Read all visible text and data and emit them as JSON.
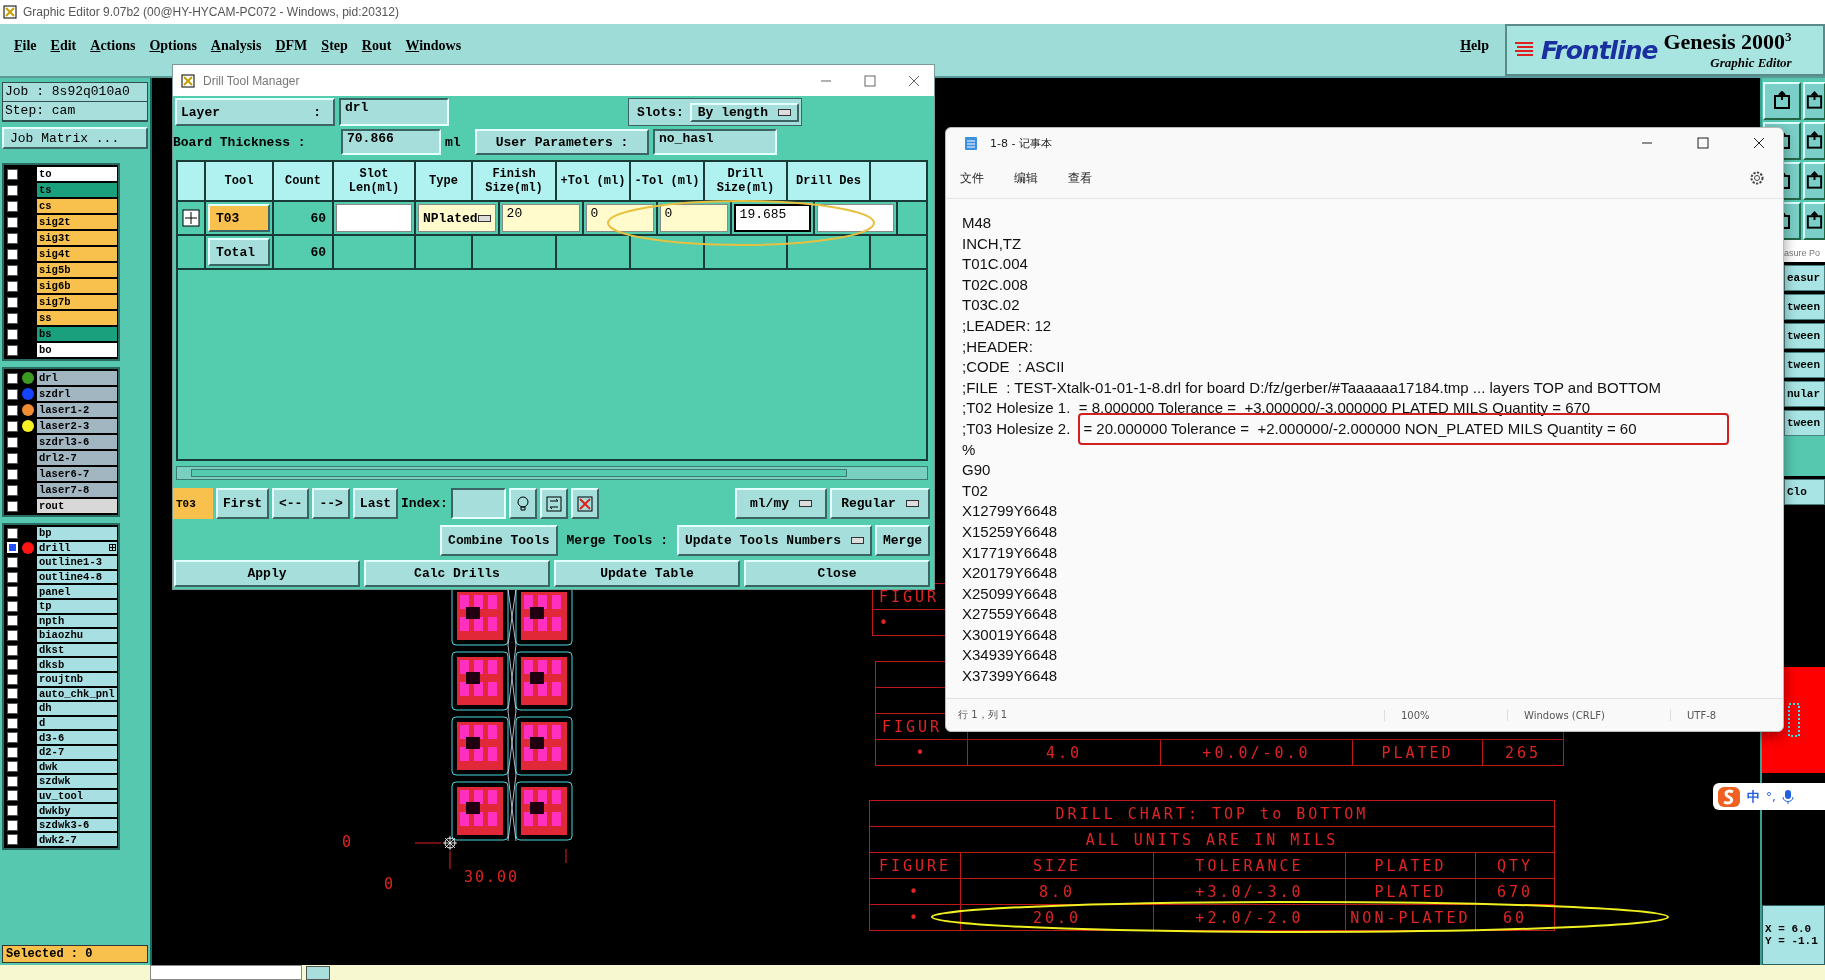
{
  "app": {
    "title": "Graphic Editor 9.07b2 (00@HY-HYCAM-PC072 - Windows, pid:20312)",
    "menus": [
      "File",
      "Edit",
      "Actions",
      "Options",
      "Analysis",
      "DFM",
      "Step",
      "Rout",
      "Windows"
    ],
    "help": "Help",
    "logo": {
      "brand": "Frontline",
      "product": "Genesis 2000",
      "superscript": "3",
      "subtitle": "Graphic Editor"
    }
  },
  "job_panel": {
    "job": "Job : 8s92q010a0",
    "step": "Step: cam",
    "matrix_button": "Job Matrix ...",
    "layer_groups": [
      {
        "layers": [
          {
            "name": "to",
            "kind": "silk",
            "selected": false
          },
          {
            "name": "ts",
            "kind": "mask",
            "selected": false
          },
          {
            "name": "cs",
            "kind": "signal",
            "selected": false
          },
          {
            "name": "sig2t",
            "kind": "signal",
            "selected": false
          },
          {
            "name": "sig3t",
            "kind": "signal",
            "selected": false
          },
          {
            "name": "sig4t",
            "kind": "signal",
            "selected": false
          },
          {
            "name": "sig5b",
            "kind": "signal",
            "selected": false
          },
          {
            "name": "sig6b",
            "kind": "signal",
            "selected": false
          },
          {
            "name": "sig7b",
            "kind": "signal",
            "selected": false
          },
          {
            "name": "ss",
            "kind": "signal",
            "selected": false
          },
          {
            "name": "bs",
            "kind": "mask",
            "selected": false
          },
          {
            "name": "bo",
            "kind": "silk",
            "selected": false
          }
        ]
      },
      {
        "layers": [
          {
            "name": "drl",
            "kind": "drill",
            "color": "#3c9a22",
            "selected": false
          },
          {
            "name": "szdrl",
            "kind": "drill",
            "color": "#1444ff",
            "selected": false
          },
          {
            "name": "laser1-2",
            "kind": "drill",
            "color": "#f28c32",
            "selected": false
          },
          {
            "name": "laser2-3",
            "kind": "drill",
            "color": "#f8f024",
            "selected": false
          },
          {
            "name": "szdrl3-6",
            "kind": "drill",
            "selected": false
          },
          {
            "name": "drl2-7",
            "kind": "drill",
            "selected": false
          },
          {
            "name": "laser6-7",
            "kind": "drill",
            "selected": false
          },
          {
            "name": "laser7-8",
            "kind": "drill",
            "selected": false
          },
          {
            "name": "rout",
            "kind": "rout",
            "selected": false
          }
        ]
      },
      {
        "layers": [
          {
            "name": "bp",
            "kind": "misc",
            "selected": false
          },
          {
            "name": "drill",
            "kind": "misc",
            "color": "#ff1414",
            "selected": true
          },
          {
            "name": "outline1-3",
            "kind": "misc",
            "selected": false
          },
          {
            "name": "outline4-8",
            "kind": "misc",
            "selected": false
          },
          {
            "name": "panel",
            "kind": "misc",
            "selected": false
          },
          {
            "name": "tp",
            "kind": "misc",
            "selected": false
          },
          {
            "name": "npth",
            "kind": "misc",
            "selected": false
          },
          {
            "name": "biaozhu",
            "kind": "misc",
            "selected": false
          },
          {
            "name": "dkst",
            "kind": "misc",
            "selected": false
          },
          {
            "name": "dksb",
            "kind": "misc",
            "selected": false
          },
          {
            "name": "roujtnb",
            "kind": "misc",
            "selected": false
          },
          {
            "name": "auto_chk_pnl",
            "kind": "misc",
            "selected": false
          },
          {
            "name": "dh",
            "kind": "misc",
            "selected": false
          },
          {
            "name": "d",
            "kind": "misc",
            "selected": false
          },
          {
            "name": "d3-6",
            "kind": "misc",
            "selected": false
          },
          {
            "name": "d2-7",
            "kind": "misc",
            "selected": false
          },
          {
            "name": "dwk",
            "kind": "misc",
            "selected": false
          },
          {
            "name": "szdwk",
            "kind": "misc",
            "selected": false
          },
          {
            "name": "uv_tool",
            "kind": "misc",
            "selected": false
          },
          {
            "name": "dwkby",
            "kind": "misc",
            "selected": false
          },
          {
            "name": "szdwk3-6",
            "kind": "misc",
            "selected": false
          },
          {
            "name": "dwk2-7",
            "kind": "misc",
            "selected": false
          }
        ]
      }
    ],
    "selected_count": "Selected : 0"
  },
  "drill_manager": {
    "title": "Drill Tool Manager",
    "layer": {
      "label": "Layer",
      "suffix": ":",
      "value": "drl"
    },
    "slots": {
      "label": "Slots:",
      "value": "By length"
    },
    "board_thickness": {
      "label": "Board Thickness :",
      "value": "70.866",
      "unit": "ml"
    },
    "user_parameters": {
      "label": "User Parameters :",
      "value": "no_hasl"
    },
    "table": {
      "columns": [
        "Tool",
        "Count",
        "Slot Len(ml)",
        "Type",
        "Finish Size(ml)",
        "+Tol (ml)",
        "-Tol (ml)",
        "Drill Size(ml)",
        "Drill Des"
      ],
      "rows": [
        {
          "kind": "tool",
          "tool": "T03",
          "count": "60",
          "slot_len": {
            "modified": false
          },
          "type": {
            "value": "NPlated",
            "modified": true
          },
          "finish_size": {
            "value": "20",
            "modified": true
          },
          "plus_tol": {
            "value": "0",
            "modified": true
          },
          "minus_tol": {
            "value": "0",
            "modified": true
          },
          "drill_size": {
            "value": "19.685",
            "modified": false
          },
          "drill_des": {
            "modified": false
          }
        },
        {
          "kind": "total",
          "tool": "Total",
          "count": "60"
        }
      ]
    },
    "current_tool": "T03",
    "nav_buttons": [
      "First",
      "<--",
      "-->",
      "Last"
    ],
    "index_label": "Index:",
    "units": "ml/my",
    "mode": "Regular",
    "combine_button": "Combine Tools",
    "merge_label": "Merge Tools :",
    "merge_option": "Update Tools Numbers",
    "merge_button": "Merge",
    "actions": [
      "Apply",
      "Calc Drills",
      "Update Table",
      "Close"
    ]
  },
  "notepad": {
    "title": "1-8 - 记事本",
    "menus": [
      "文件",
      "编辑",
      "查看"
    ],
    "lines": [
      {
        "text": "M48"
      },
      {
        "text": "INCH,TZ"
      },
      {
        "text": "T01C.004"
      },
      {
        "text": "T02C.008"
      },
      {
        "text": "T03C.02"
      },
      {
        "text": ";LEADER: 12"
      },
      {
        "text": ";HEADER:"
      },
      {
        "text": ";CODE  : ASCII"
      },
      {
        "text": ";FILE  : TEST-Xtalk-01-01-1-8.drl for board D:/fz/gerber/#Taaaaaa17184.tmp ... layers TOP and BOTTOM"
      },
      {
        "text": ";T02 Holesize 1.  = 8.000000 Tolerance =  +3.000000/-3.000000 PLATED MILS Quantity = 670"
      },
      {
        "text": ";T03 Holesize 2.",
        "marked": "= 20.000000 Tolerance =  +2.000000/-2.000000 NON_PLATED MILS Quantity = 60"
      },
      {
        "text": "%"
      },
      {
        "text": "G90"
      },
      {
        "text": "T02"
      },
      {
        "text": "X12799Y6648"
      },
      {
        "text": "X15259Y6648"
      },
      {
        "text": "X17719Y6648"
      },
      {
        "text": "X20179Y6648"
      },
      {
        "text": "X25099Y6648"
      },
      {
        "text": "X27559Y6648"
      },
      {
        "text": "X30019Y6648"
      },
      {
        "text": "X34939Y6648"
      },
      {
        "text": "X37399Y6648"
      }
    ],
    "status": {
      "position": "行 1，列 1",
      "zoom": "100%",
      "line_ending": "Windows (CRLF)",
      "encoding": "UTF-8"
    }
  },
  "canvas": {
    "chart_a": {
      "header_fragment": "FIGUR",
      "row_fragment": "•"
    },
    "chart_b": {
      "header_fragment": "FIGUR",
      "row": [
        "•",
        "4.0",
        "+0.0/-0.0",
        "PLATED",
        "265"
      ]
    },
    "drill_chart": {
      "title": "DRILL CHART: TOP to BOTTOM",
      "subtitle": "ALL UNITS ARE IN MILS",
      "columns": [
        "FIGURE",
        "SIZE",
        "TOLERANCE",
        "PLATED",
        "QTY"
      ],
      "rows": [
        [
          "•",
          "8.0",
          "+3.0/-3.0",
          "PLATED",
          "670"
        ],
        [
          "•",
          "20.0",
          "+2.0/-2.0",
          "NON-PLATED",
          "60"
        ]
      ]
    },
    "axis": {
      "y_origin": "0",
      "x_origin": "0",
      "x_end": "30.00"
    }
  },
  "right_panel": {
    "heading_fragment": "asure Po",
    "items": [
      "easur",
      "tween",
      "tween",
      "tween",
      "nular",
      "tween"
    ],
    "close_fragment": "Clo",
    "coords": [
      "X = 6.0",
      "Y = -1.1"
    ]
  },
  "ime": {
    "mode": "中",
    "punct": "°,"
  }
}
